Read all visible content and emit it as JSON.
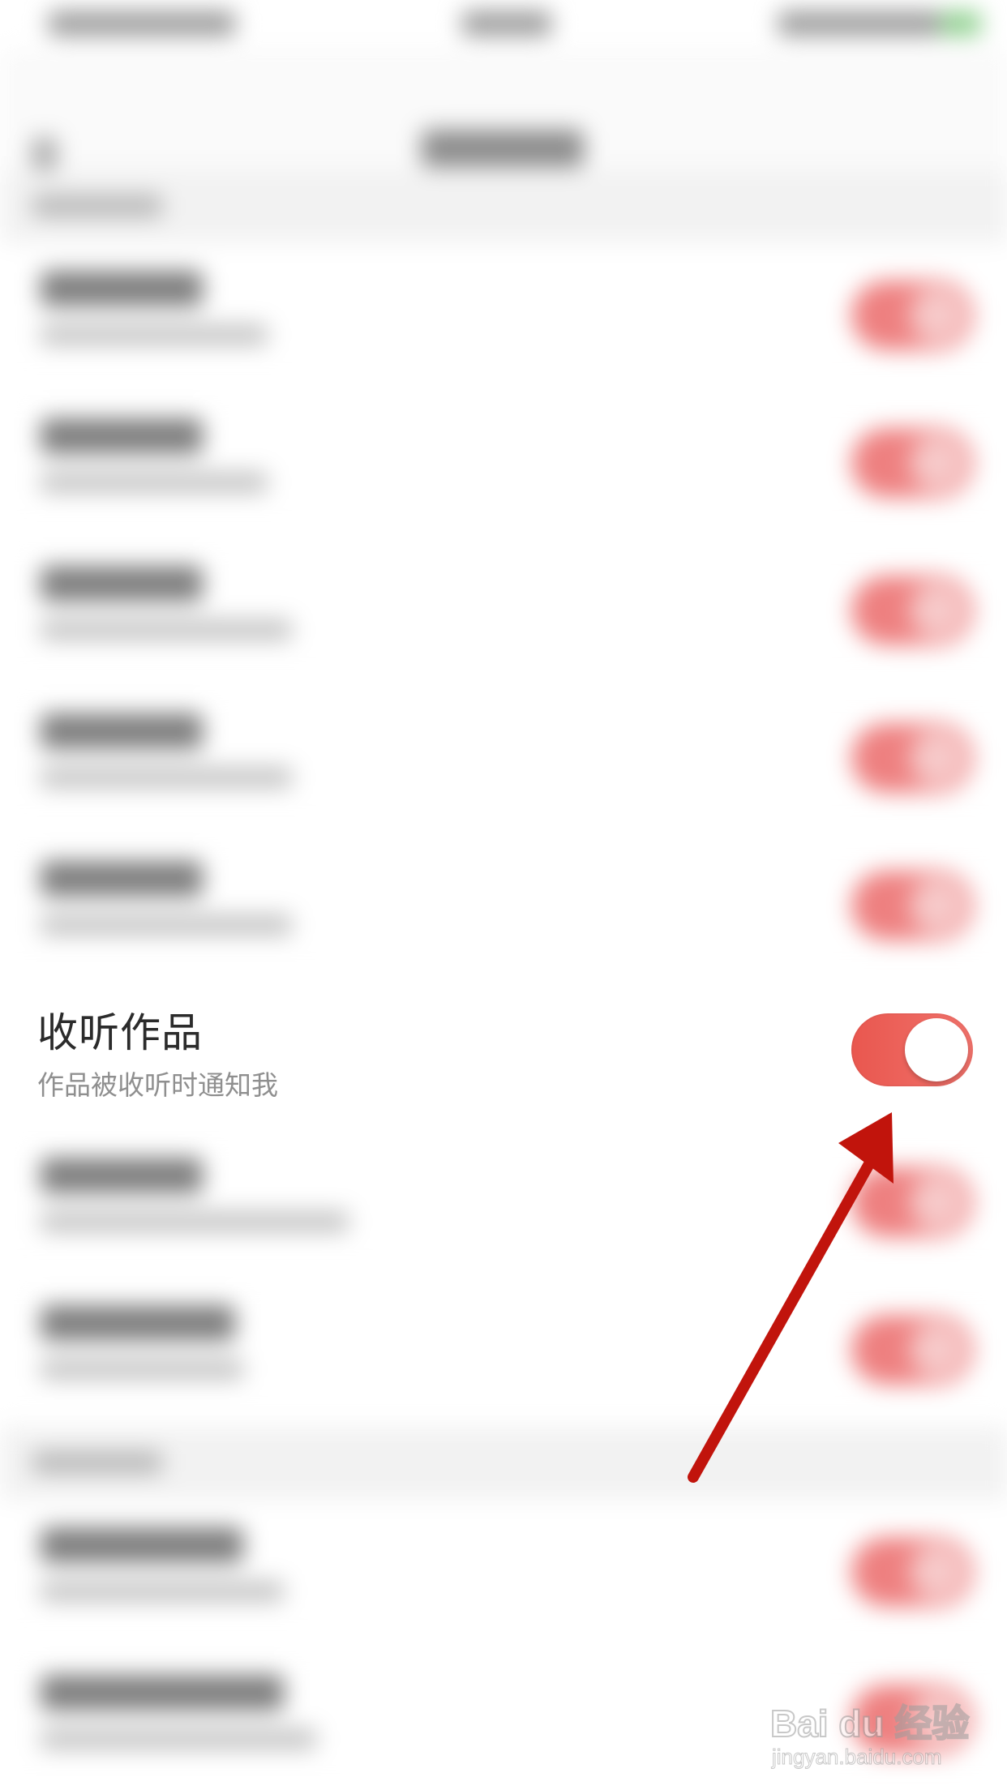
{
  "focused_setting": {
    "title": "收听作品",
    "subtitle": "作品被收听时通知我",
    "toggle_state": "on",
    "toggle_color": "#E9574F"
  },
  "annotation": {
    "type": "arrow",
    "color": "#C1140C",
    "points_to": "focused_setting.toggle"
  },
  "watermark": {
    "logo": "Bai du 经验",
    "url": "jingyan.baidu.com"
  }
}
